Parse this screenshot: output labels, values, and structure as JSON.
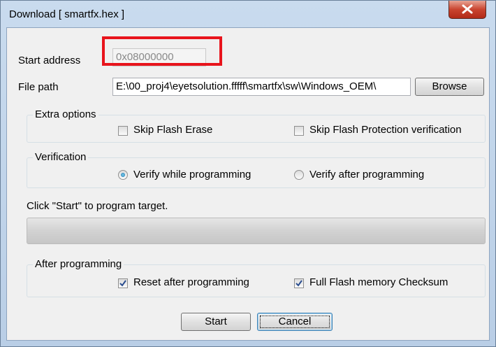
{
  "window": {
    "title": "Download [ smartfx.hex ]",
    "close_icon": "close-x-icon"
  },
  "start_address": {
    "label": "Start address",
    "value": "0x08000000",
    "enabled": false
  },
  "file_path": {
    "label": "File path",
    "value": "E:\\00_proj4\\eyetsolution.fffff\\smartfx\\sw\\Windows_OEM\\",
    "browse_label": "Browse"
  },
  "extra_options": {
    "title": "Extra options",
    "skip_flash_erase": {
      "label": "Skip Flash Erase",
      "checked": false
    },
    "skip_protection": {
      "label": "Skip Flash Protection verification",
      "checked": false
    }
  },
  "verification": {
    "title": "Verification",
    "verify_while": {
      "label": "Verify while programming",
      "selected": true
    },
    "verify_after": {
      "label": "Verify after programming",
      "selected": false
    }
  },
  "status": {
    "text": "Click \"Start\" to program target.",
    "progress": 0
  },
  "after_programming": {
    "title": "After programming",
    "reset": {
      "label": "Reset after programming",
      "checked": true
    },
    "checksum": {
      "label": "Full Flash memory Checksum",
      "checked": true
    }
  },
  "buttons": {
    "start_label": "Start",
    "cancel_label": "Cancel"
  },
  "colors": {
    "highlight": "#e8141c",
    "close_button": "#c9442f",
    "dialog_bg": "#f0f0f0"
  }
}
